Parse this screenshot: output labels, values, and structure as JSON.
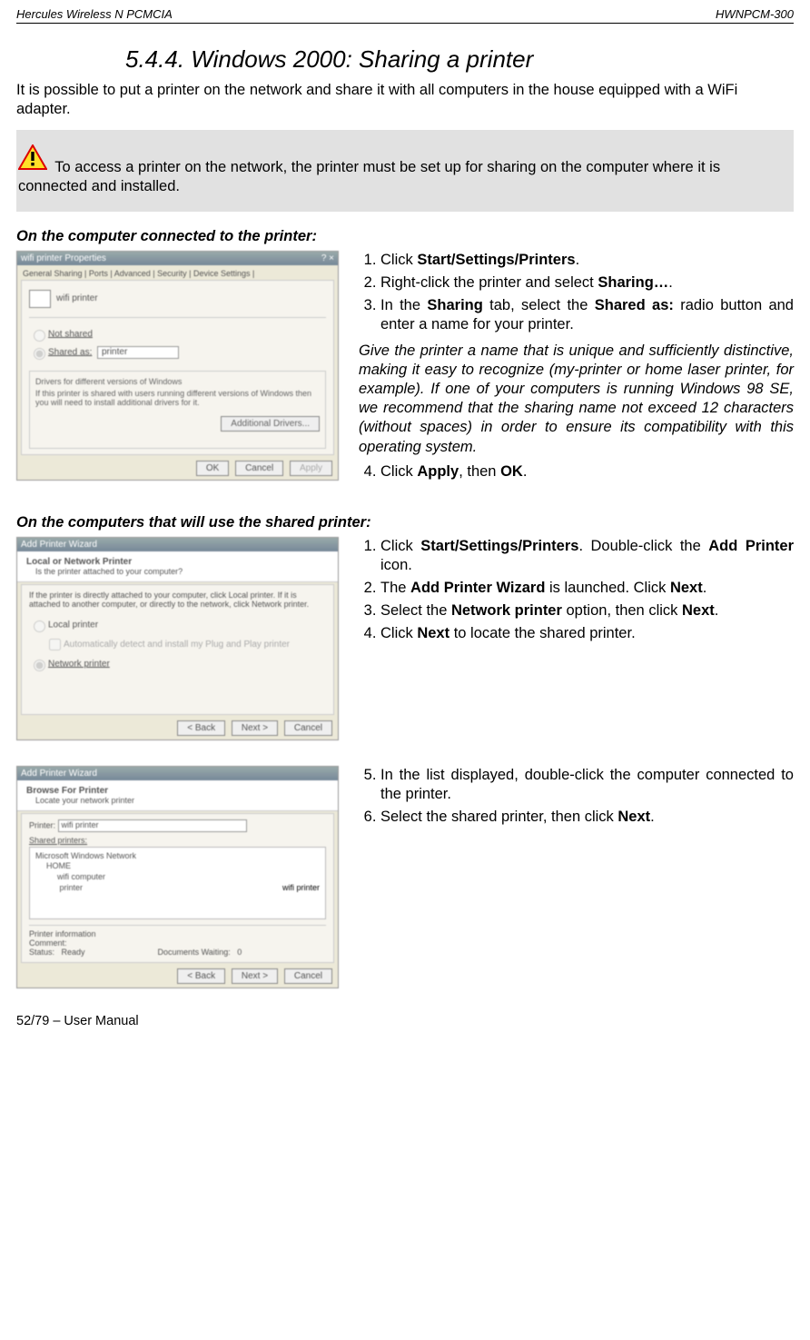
{
  "header": {
    "left": "Hercules Wireless N PCMCIA",
    "right": "HWNPCM-300"
  },
  "section_title": "5.4.4. Windows 2000: Sharing a printer",
  "intro": "It is possible to put a printer on the network and share it with all computers in the house equipped with a WiFi adapter.",
  "note": " To access a printer on the network, the printer must be set up for sharing on the computer where it is connected and installed.",
  "sub1": "On the computer connected to the printer:",
  "steps1": {
    "s1a": "Click ",
    "s1b": "Start/Settings/Printers",
    "s1c": ".",
    "s2a": "Right-click the printer and select ",
    "s2b": "Sharing…",
    "s2c": ".",
    "s3a": "In the ",
    "s3b": "Sharing",
    "s3c": " tab, select the ",
    "s3d": "Shared as:",
    "s3e": " radio button and enter a name for your printer.",
    "s4a": "Click ",
    "s4b": "Apply",
    "s4c": ", then ",
    "s4d": "OK",
    "s4e": "."
  },
  "italic1": "Give the printer a name that is unique and sufficiently distinctive, making it easy to recognize (my-printer or home laser printer, for example).  If one of your computers is running Windows 98 SE, we recommend that the sharing name not exceed 12 characters (without spaces) in order to ensure its compatibility with this operating system.",
  "sub2": "On the computers that will use the shared printer:",
  "steps2": {
    "s1a": "Click ",
    "s1b": "Start/Settings/Printers",
    "s1c": ". Double-click the ",
    "s1d": "Add Printer",
    "s1e": " icon.",
    "s2a": "The ",
    "s2b": "Add Printer Wizard",
    "s2c": " is launched.  Click ",
    "s2d": "Next",
    "s2e": ".",
    "s3a": "Select the ",
    "s3b": "Network printer",
    "s3c": " option, then click ",
    "s3d": "Next",
    "s3e": ".",
    "s4a": "Click ",
    "s4b": "Next",
    "s4c": " to locate the shared printer."
  },
  "steps3": {
    "s5a": "In the list displayed, double-click the computer connected to the printer.",
    "s6a": "Select the shared printer, then click ",
    "s6b": "Next",
    "s6c": "."
  },
  "footer": "52/79 – User Manual",
  "win1": {
    "title": "wifi printer Properties",
    "tabs": "General   Sharing | Ports | Advanced | Security | Device Settings |",
    "printer_label": "wifi printer",
    "r1": "Not shared",
    "r2": "Shared as:",
    "share_val": "printer",
    "drv_title": "Drivers for different versions of Windows",
    "drv_text": "If this printer is shared with users running different versions of Windows then you will need to install additional drivers for it.",
    "drv_btn": "Additional Drivers...",
    "ok": "OK",
    "cancel": "Cancel",
    "apply": "Apply"
  },
  "win2": {
    "title": "Add Printer Wizard",
    "h": "Local or Network Printer",
    "sub": "Is the printer attached to your computer?",
    "desc": "If the printer is directly attached to your computer, click Local printer. If it is attached to another computer, or directly to the network, click Network printer.",
    "opt1": "Local printer",
    "opt1b": "Automatically detect and install my Plug and Play printer",
    "opt2": "Network printer",
    "back": "< Back",
    "next": "Next >",
    "cancel": "Cancel"
  },
  "win3": {
    "title": "Add Printer Wizard",
    "h": "Browse For Printer",
    "sub": "Locate your network printer",
    "plabel": "Printer:",
    "pval": "wifi printer",
    "shared": "Shared printers:",
    "tree1": "Microsoft Windows Network",
    "tree2": "HOME",
    "tree3": "wifi computer",
    "tree4": "printer",
    "tree4b": "wifi printer",
    "info": "Printer information",
    "comment": "Comment:",
    "status": "Status:",
    "ready": "Ready",
    "docw": "Documents Waiting:",
    "zero": "0",
    "back": "< Back",
    "next": "Next >",
    "cancel": "Cancel"
  }
}
